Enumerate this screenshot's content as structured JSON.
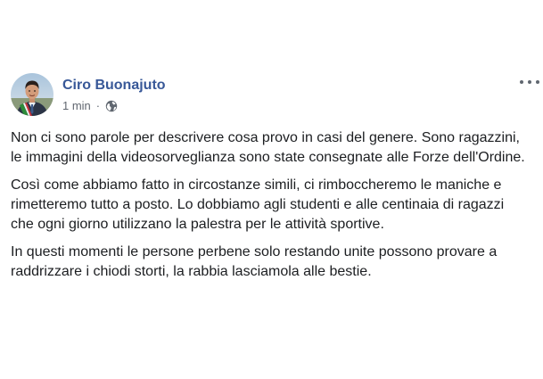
{
  "post": {
    "author": "Ciro Buonajuto",
    "time": "1 min",
    "separator": "·",
    "audience_icon": "globe-icon",
    "menu_icon": "more-options-icon",
    "paragraphs": [
      "Non ci sono parole per descrivere cosa provo in casi del genere. Sono ragazzini, le immagini della videosorveglianza sono state consegnate alle Forze dell'Ordine.",
      "Così come abbiamo fatto in circostanze simili, ci rimboccheremo le maniche e rimetteremo tutto a posto. Lo dobbiamo agli studenti e alle centinaia di ragazzi che ogni giorno utilizzano la palestra per le attività sportive.",
      "In questi momenti le persone perbene solo restando unite possono provare a raddrizzare i chiodi storti, la rabbia lasciamola alle bestie."
    ]
  },
  "colors": {
    "author": "#385898",
    "meta_text": "#616770",
    "body_text": "#1c1e21"
  }
}
